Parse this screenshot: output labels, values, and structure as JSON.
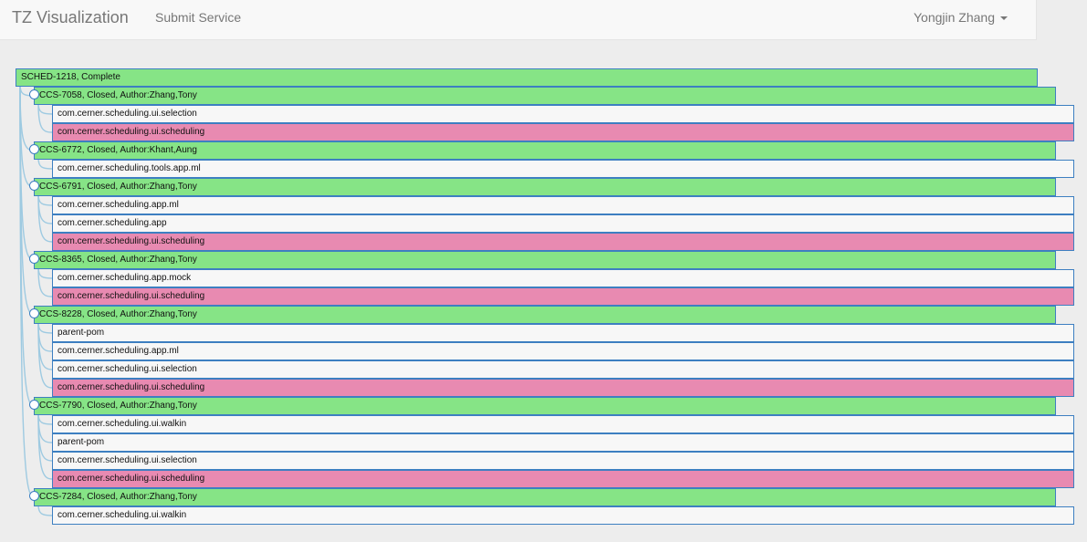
{
  "navbar": {
    "brand": "TZ Visualization",
    "submit_link": "Submit Service",
    "user": "Yongjin Zhang"
  },
  "colors": {
    "ticket_bg": "#86e486",
    "module_bg": "#f7f7f7",
    "module_changed_bg": "#e88ab1",
    "border": "#3d7fc1",
    "link_line": "#9ecae1"
  },
  "tree": {
    "root": "SCHED-1218, Complete",
    "tickets": [
      {
        "label": "CCS-7058, Closed, Author:Zhang,Tony",
        "modules": [
          {
            "label": "com.cerner.scheduling.ui.selection",
            "changed": false
          },
          {
            "label": "com.cerner.scheduling.ui.scheduling",
            "changed": true
          }
        ]
      },
      {
        "label": "CCS-6772, Closed, Author:Khant,Aung",
        "modules": [
          {
            "label": "com.cerner.scheduling.tools.app.ml",
            "changed": false
          }
        ]
      },
      {
        "label": "CCS-6791, Closed, Author:Zhang,Tony",
        "modules": [
          {
            "label": "com.cerner.scheduling.app.ml",
            "changed": false
          },
          {
            "label": "com.cerner.scheduling.app",
            "changed": false
          },
          {
            "label": "com.cerner.scheduling.ui.scheduling",
            "changed": true
          }
        ]
      },
      {
        "label": "CCS-8365, Closed, Author:Zhang,Tony",
        "modules": [
          {
            "label": "com.cerner.scheduling.app.mock",
            "changed": false
          },
          {
            "label": "com.cerner.scheduling.ui.scheduling",
            "changed": true
          }
        ]
      },
      {
        "label": "CCS-8228, Closed, Author:Zhang,Tony",
        "modules": [
          {
            "label": "parent-pom",
            "changed": false
          },
          {
            "label": "com.cerner.scheduling.app.ml",
            "changed": false
          },
          {
            "label": "com.cerner.scheduling.ui.selection",
            "changed": false
          },
          {
            "label": "com.cerner.scheduling.ui.scheduling",
            "changed": true
          }
        ]
      },
      {
        "label": "CCS-7790, Closed, Author:Zhang,Tony",
        "modules": [
          {
            "label": "com.cerner.scheduling.ui.walkin",
            "changed": false
          },
          {
            "label": "parent-pom",
            "changed": false
          },
          {
            "label": "com.cerner.scheduling.ui.selection",
            "changed": false
          },
          {
            "label": "com.cerner.scheduling.ui.scheduling",
            "changed": true
          }
        ]
      },
      {
        "label": "CCS-7284, Closed, Author:Zhang,Tony",
        "modules": [
          {
            "label": "com.cerner.scheduling.ui.walkin",
            "changed": false
          }
        ]
      }
    ]
  }
}
